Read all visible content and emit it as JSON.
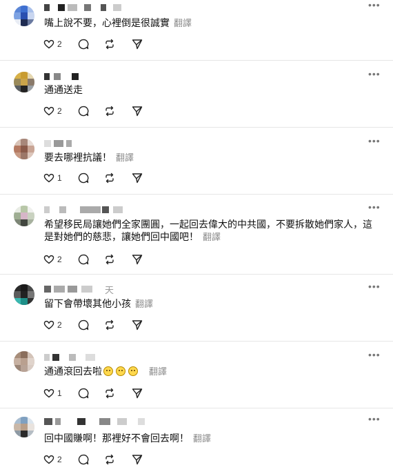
{
  "translate_label": "翻譯",
  "icons": {
    "like": "heart-icon",
    "reply": "comment-bubble-icon",
    "repost": "repost-icon",
    "share": "send-icon",
    "more": "more-dots-icon"
  },
  "colors": {
    "text": "#101010",
    "muted": "#8a8a8a",
    "divider": "#e6e6e6"
  },
  "posts": [
    {
      "text": "嘴上說不要，心裡倒是很誠實",
      "likes": "2",
      "name_suffix": "",
      "has_translate": true
    },
    {
      "text": "通通送走",
      "likes": "2",
      "name_suffix": "",
      "has_translate": false
    },
    {
      "text": "要去哪裡抗議！",
      "likes": "1",
      "name_suffix": "",
      "has_translate": true
    },
    {
      "text": "希望移民局讓她們全家團圓，一起回去偉大的中共國，不要拆散她們家人，這是對她們的慈悲，讓她們回中國吧！",
      "likes": "2",
      "name_suffix": "",
      "has_translate": true
    },
    {
      "text": "留下會帶壞其他小孩",
      "likes": "2",
      "name_suffix": "天",
      "has_translate": true
    },
    {
      "text": "通通滾回去啦",
      "likes": "1",
      "name_suffix": "",
      "has_translate": true,
      "emoji_count": 3
    },
    {
      "text": "回中國賺啊！那裡好不會回去啊！",
      "likes": "2",
      "name_suffix": "",
      "has_translate": true
    }
  ]
}
